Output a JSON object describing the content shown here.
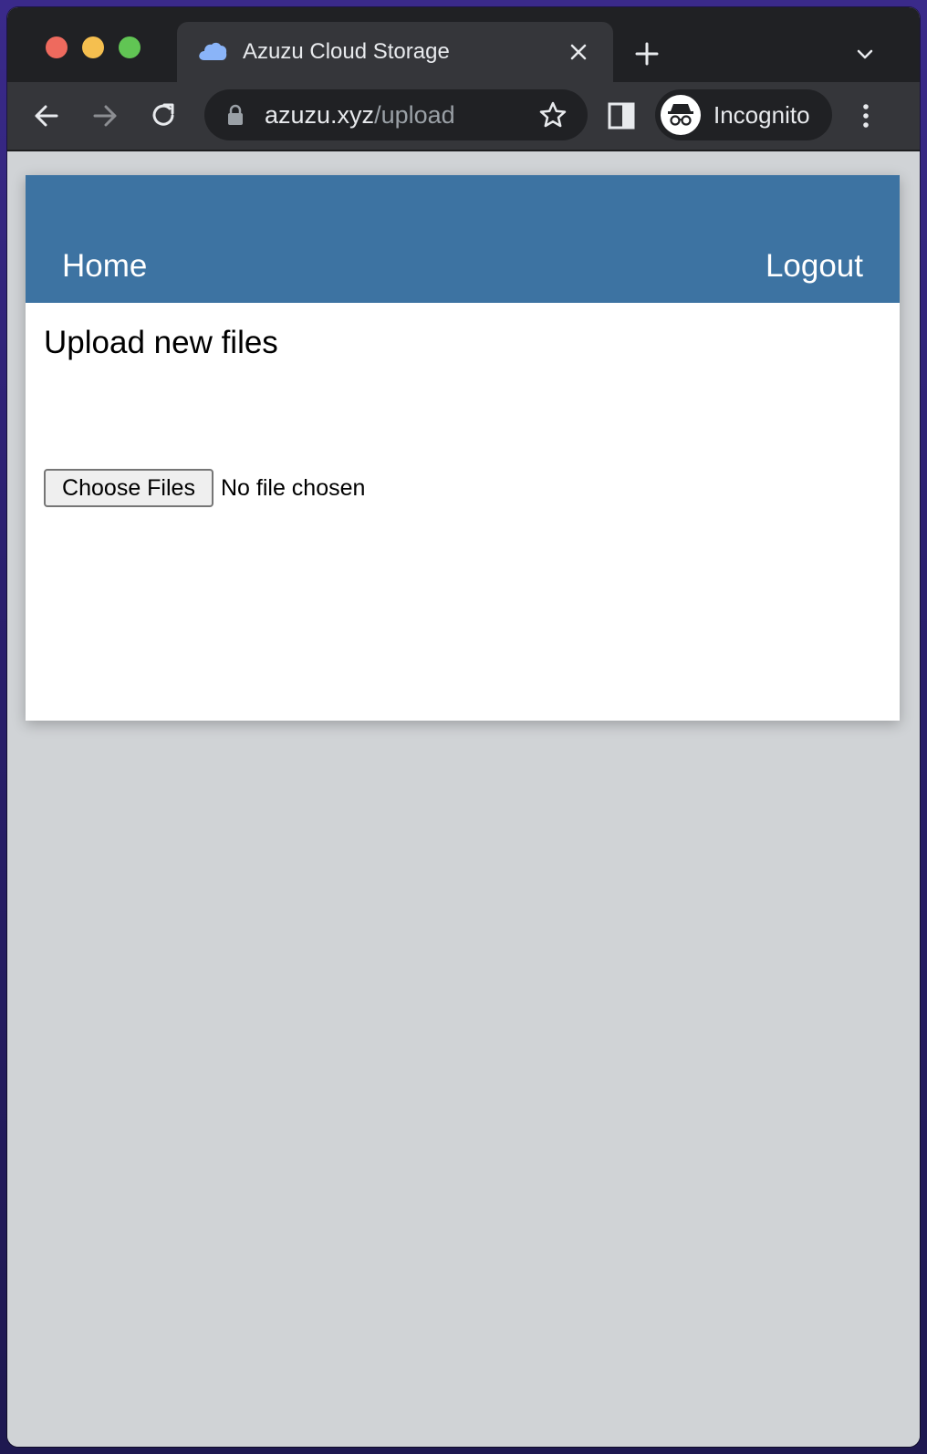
{
  "browser": {
    "tab": {
      "title": "Azuzu Cloud Storage",
      "favicon": "cloud-icon"
    },
    "address": {
      "domain": "azuzu.xyz",
      "path": "/upload"
    },
    "profile": {
      "label": "Incognito"
    },
    "colors": {
      "tabbar": "#202124",
      "toolbar": "#35363a",
      "favicon": "#8ab4f8"
    }
  },
  "page": {
    "nav": {
      "home_label": "Home",
      "logout_label": "Logout"
    },
    "title": "Upload new files",
    "file_input": {
      "button_label": "Choose Files",
      "status": "No file chosen"
    },
    "colors": {
      "navbar": "#3d73a2",
      "background": "#d0d3d6"
    }
  }
}
